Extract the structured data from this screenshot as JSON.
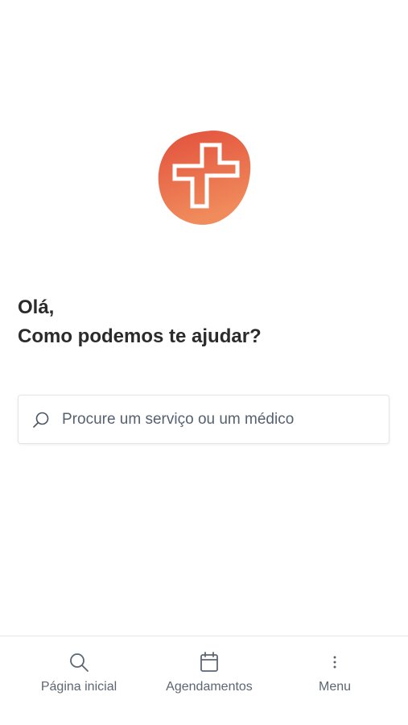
{
  "logo": {
    "icon": "medical-cross-logo",
    "colors": {
      "start": "#e5563f",
      "end": "#ef8a5a"
    }
  },
  "greeting": {
    "line1": "Olá,",
    "line2": "Como podemos te ajudar?"
  },
  "search": {
    "placeholder": "Procure um serviço ou um médico",
    "icon": "search-icon"
  },
  "bottom_nav": {
    "items": [
      {
        "label": "Página inicial",
        "icon": "search-icon"
      },
      {
        "label": "Agendamentos",
        "icon": "calendar-icon"
      },
      {
        "label": "Menu",
        "icon": "more-vertical-icon"
      }
    ]
  }
}
